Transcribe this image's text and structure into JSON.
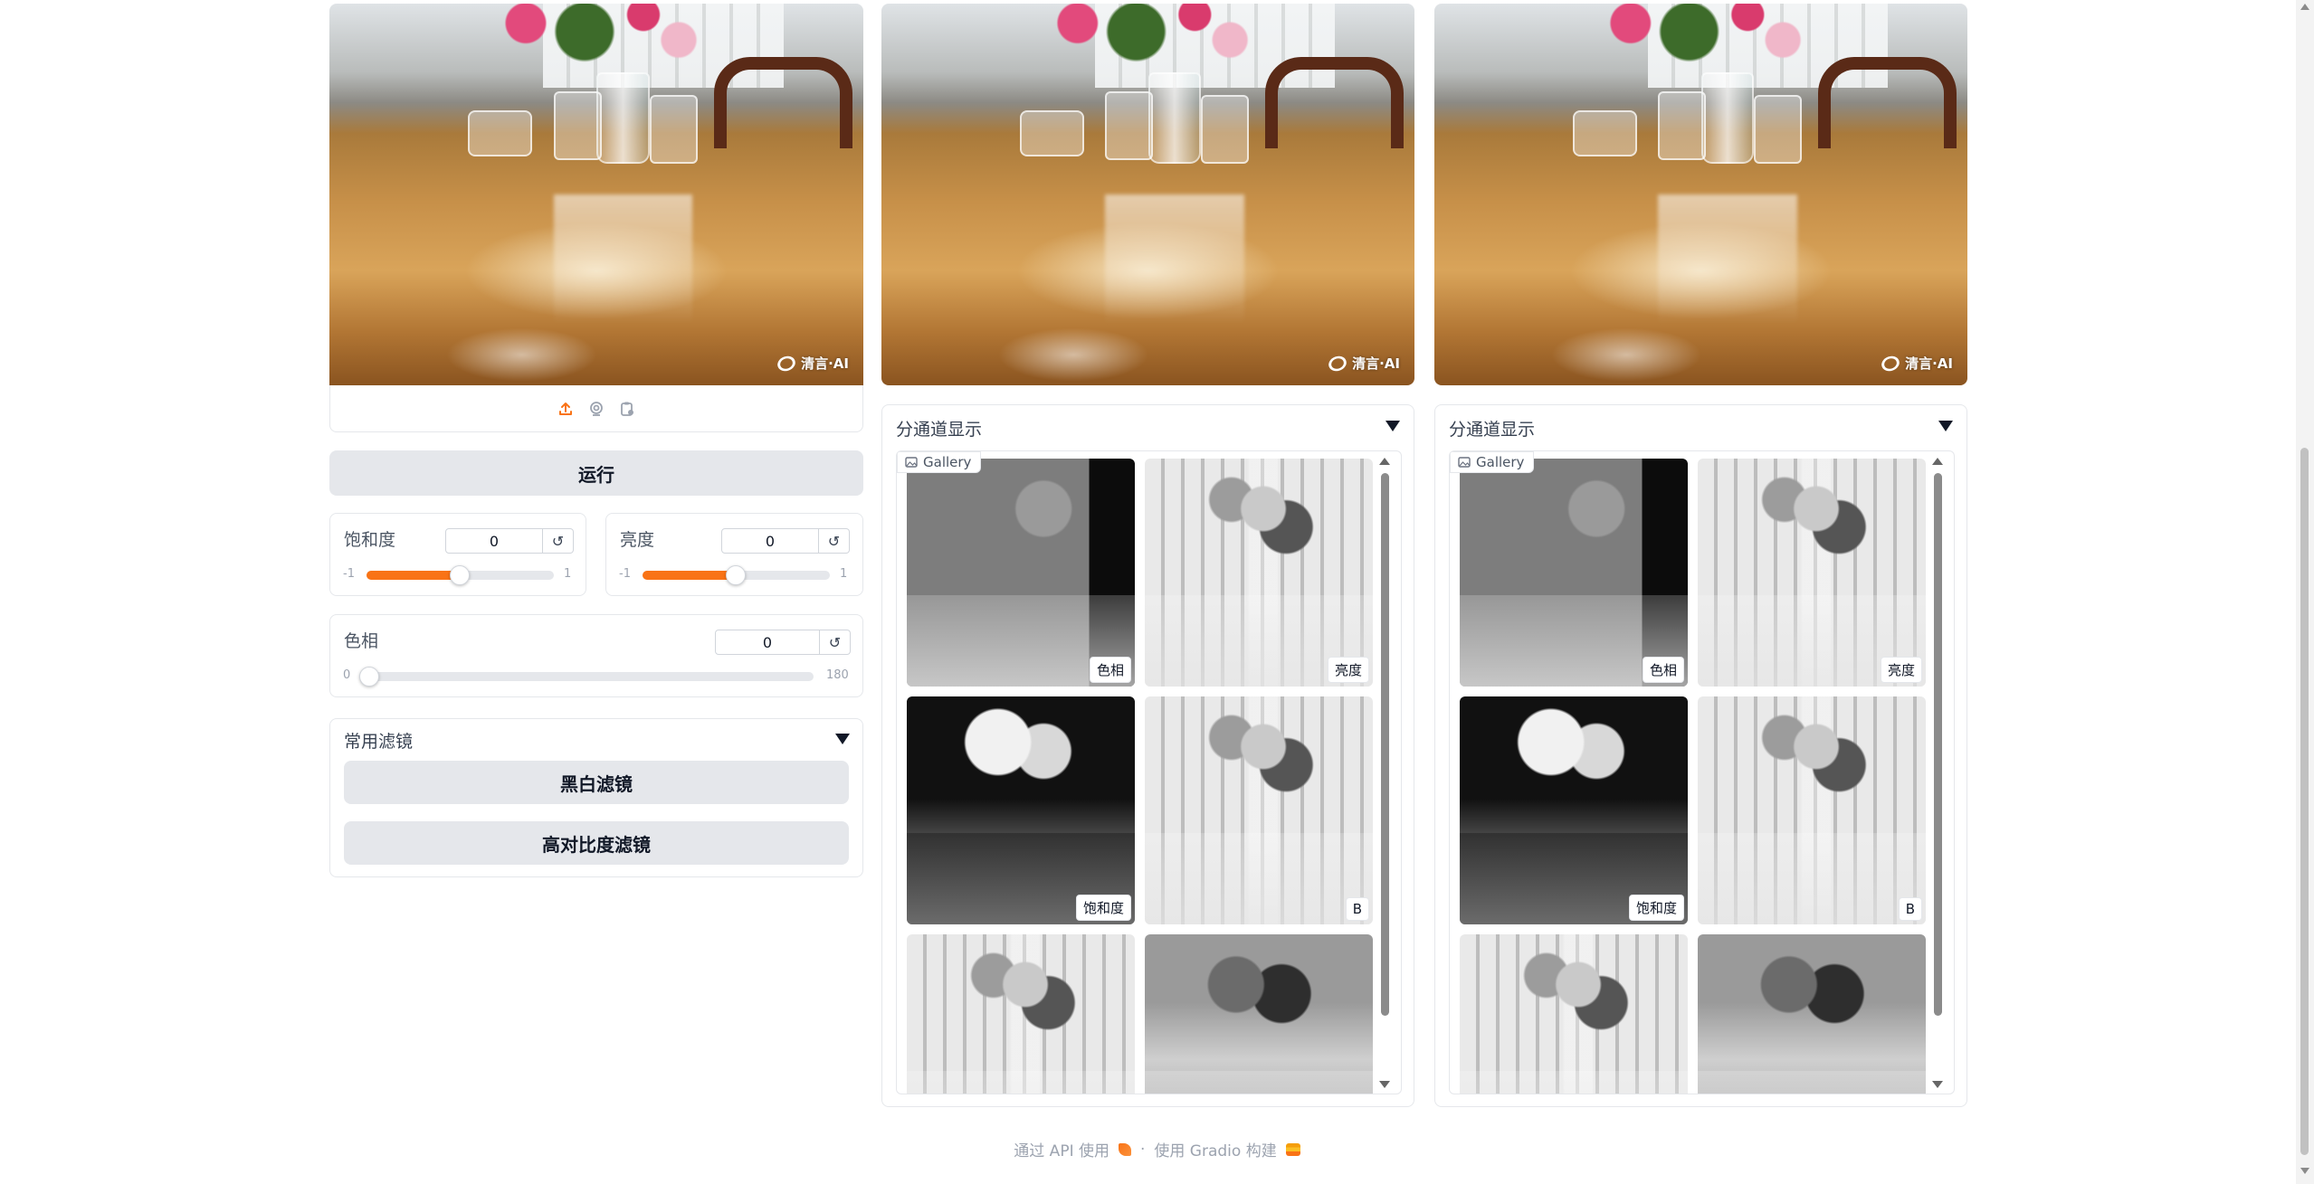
{
  "images": {
    "watermark": "清言·AI"
  },
  "controls": {
    "run_label": "运行",
    "saturation": {
      "label": "饱和度",
      "value": "0",
      "min": "-1",
      "max": "1",
      "level": 0.5
    },
    "brightness": {
      "label": "亮度",
      "value": "0",
      "min": "-1",
      "max": "1",
      "level": 0.5
    },
    "hue": {
      "label": "色相",
      "value": "0",
      "min": "0",
      "max": "180",
      "level": 0.0
    },
    "filters": {
      "title": "常用滤镜",
      "bw_label": "黑白滤镜",
      "contrast_label": "高对比度滤镜"
    }
  },
  "channels": [
    {
      "title": "分通道显示",
      "gallery_label": "Gallery",
      "items": [
        "色相",
        "亮度",
        "饱和度",
        "B",
        "",
        ""
      ]
    },
    {
      "title": "分通道显示",
      "gallery_label": "Gallery",
      "items": [
        "色相",
        "亮度",
        "饱和度",
        "B",
        "",
        ""
      ]
    }
  ],
  "footer": {
    "api_text": "通过 API 使用",
    "separator": "·",
    "built_text": "使用 Gradio 构建"
  },
  "colors": {
    "accent": "#f97316",
    "button_bg": "#e5e7eb"
  },
  "icons": [
    "upload-icon",
    "webcam-icon",
    "clipboard-icon",
    "reset-icon",
    "gallery-image-icon",
    "rocket-icon",
    "gradio-logo-icon"
  ]
}
